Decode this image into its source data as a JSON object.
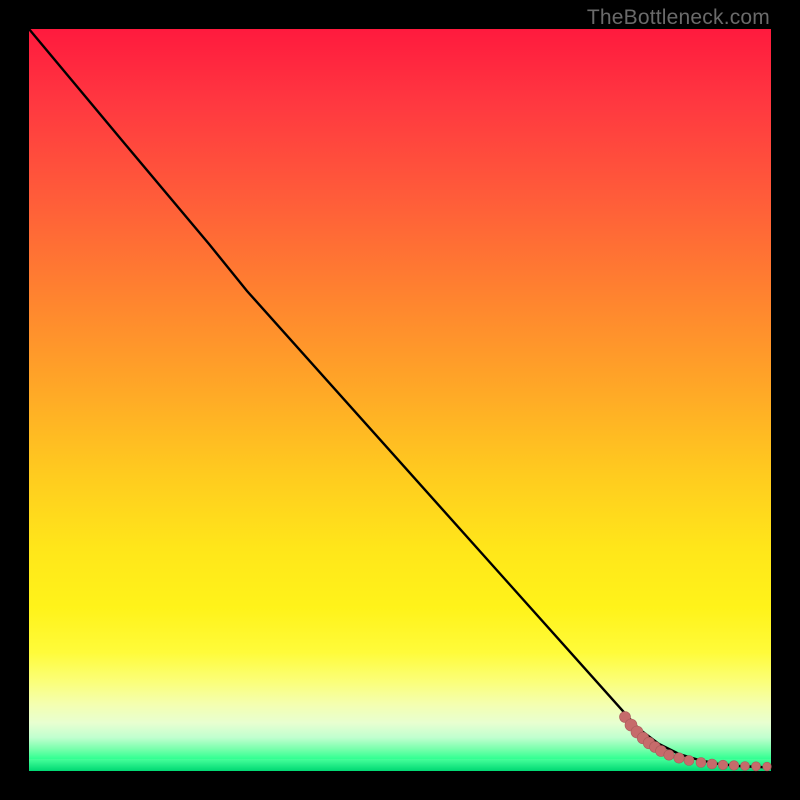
{
  "watermark": "TheBottleneck.com",
  "colors": {
    "line": "#000000",
    "dots": "#c66b6b",
    "dot_stroke": "#aa5b5b"
  },
  "chart_data": {
    "type": "line",
    "title": "",
    "xlabel": "",
    "ylabel": "",
    "xlim": [
      0,
      100
    ],
    "ylim": [
      0,
      100
    ],
    "series": [
      {
        "name": "bottleneck-curve",
        "x": [
          0,
          5,
          10,
          15,
          20,
          25,
          30,
          35,
          40,
          45,
          50,
          55,
          60,
          65,
          70,
          75,
          80,
          82,
          84,
          86,
          88,
          90,
          92,
          94,
          96,
          98,
          100
        ],
        "y": [
          100,
          96,
          92,
          87,
          82,
          77,
          71,
          64,
          57,
          50,
          43,
          36,
          29,
          23,
          17,
          12,
          8,
          6,
          5,
          4,
          3,
          2.2,
          1.6,
          1.2,
          1.0,
          0.8,
          0.7
        ]
      }
    ],
    "scatter": {
      "name": "measured-points",
      "x": [
        80.0,
        80.8,
        81.6,
        82.3,
        83.1,
        83.9,
        84.7,
        86.0,
        87.2,
        88.5,
        89.8,
        91.0,
        92.2,
        93.5,
        94.7,
        96.0,
        97.5,
        99.2
      ],
      "y": [
        8.0,
        7.0,
        6.1,
        5.3,
        4.6,
        4.0,
        3.5,
        2.8,
        2.2,
        1.8,
        1.5,
        1.3,
        1.1,
        1.0,
        0.9,
        0.85,
        0.8,
        0.75
      ]
    }
  }
}
